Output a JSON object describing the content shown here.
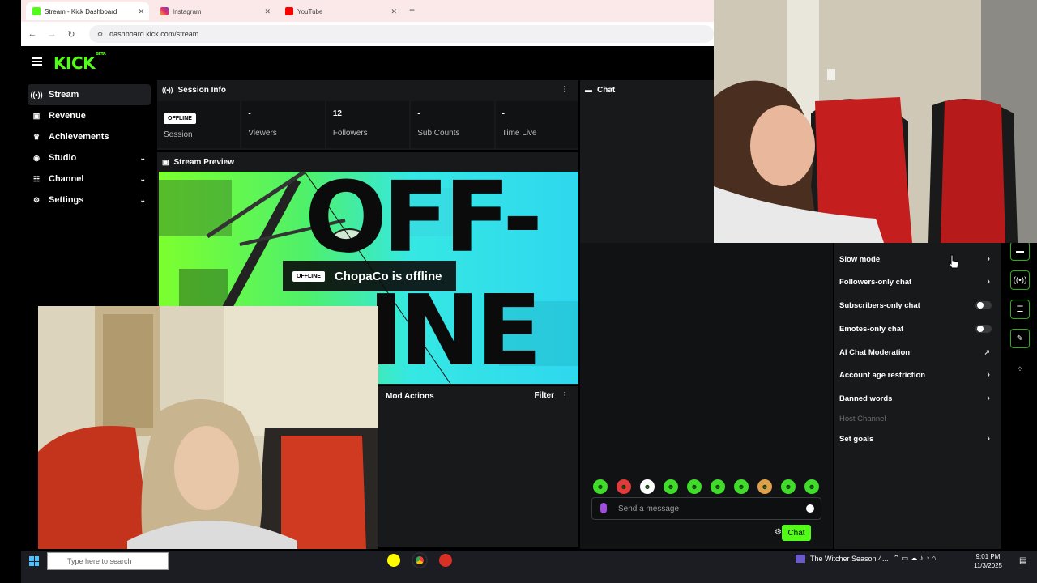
{
  "browser": {
    "tabs": [
      {
        "label": "Stream - Kick Dashboard",
        "active": true
      },
      {
        "label": "Instagram",
        "active": false
      },
      {
        "label": "YouTube",
        "active": false
      }
    ],
    "url": "dashboard.kick.com/stream"
  },
  "app": {
    "logo": "KICK",
    "logo_suffix": "BETA"
  },
  "sidebar": {
    "items": [
      {
        "label": "Stream",
        "icon": "broadcast-icon",
        "active": true
      },
      {
        "label": "Revenue",
        "icon": "money-icon"
      },
      {
        "label": "Achievements",
        "icon": "trophy-icon"
      },
      {
        "label": "Studio",
        "icon": "studio-icon",
        "expandable": true
      },
      {
        "label": "Channel",
        "icon": "channel-icon",
        "expandable": true
      },
      {
        "label": "Settings",
        "icon": "gear-icon",
        "expandable": true
      }
    ]
  },
  "session": {
    "title": "Session Info",
    "status_badge": "OFFLINE",
    "stats": [
      {
        "value": "",
        "label": "Session"
      },
      {
        "value": "-",
        "label": "Viewers"
      },
      {
        "value": "12",
        "label": "Followers"
      },
      {
        "value": "-",
        "label": "Sub Counts"
      },
      {
        "value": "-",
        "label": "Time Live"
      }
    ]
  },
  "preview": {
    "title": "Stream Preview",
    "offline_badge": "OFFLINE",
    "offline_message": "ChopaCo is offline",
    "art_text_1": "OFF-",
    "art_text_2": "INE"
  },
  "mod_actions": {
    "title": "Mod Actions",
    "filter_label": "Filter"
  },
  "chat": {
    "title": "Chat",
    "input_placeholder": "Send a message",
    "send_label": "Chat"
  },
  "chat_settings": {
    "items": [
      {
        "label": "Slow mode",
        "control": "chevron"
      },
      {
        "label": "Followers-only chat",
        "control": "chevron"
      },
      {
        "label": "Subscribers-only chat",
        "control": "toggle",
        "on": false
      },
      {
        "label": "Emotes-only chat",
        "control": "toggle",
        "on": false
      },
      {
        "label": "AI Chat Moderation",
        "control": "external"
      },
      {
        "label": "Account age restriction",
        "control": "chevron"
      },
      {
        "label": "Banned words",
        "control": "chevron"
      },
      {
        "label": "Host Channel",
        "control": "none",
        "disabled": true
      },
      {
        "label": "Set goals",
        "control": "chevron"
      }
    ]
  },
  "taskbar": {
    "search_placeholder": "Type here to search",
    "media_title": "The Witcher Season 4...",
    "time": "9:01 PM",
    "date": "11/3/2025"
  },
  "colors": {
    "kick_green": "#53fc18",
    "panel_bg": "#18191b",
    "page_bg": "#000000"
  }
}
